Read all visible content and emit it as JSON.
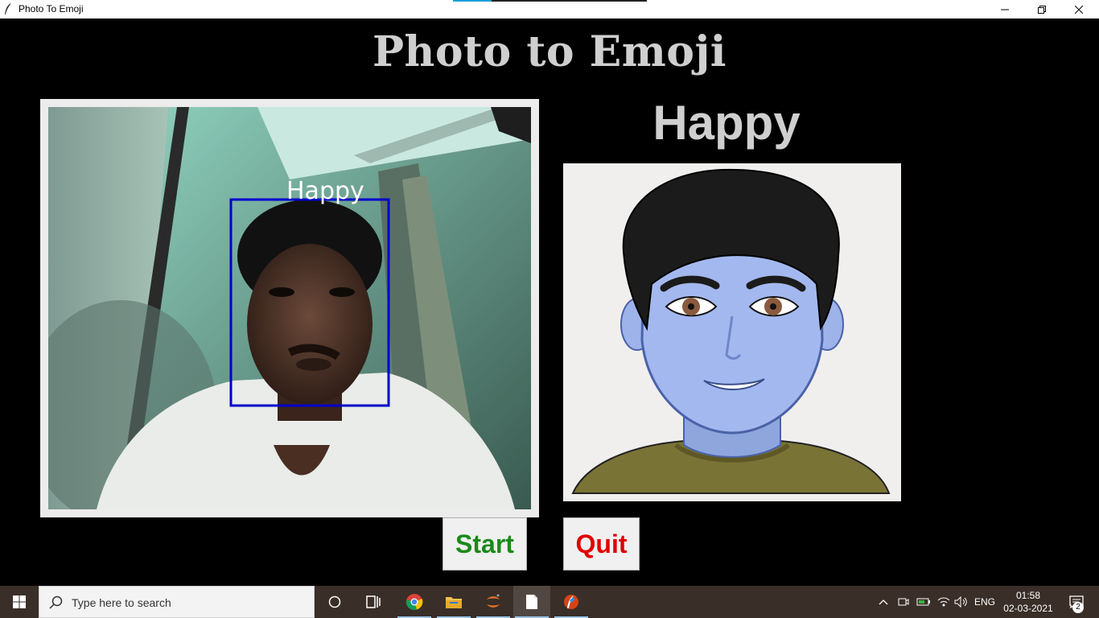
{
  "window": {
    "title": "Photo To Emoji",
    "controls": [
      "minimize",
      "restore",
      "close"
    ]
  },
  "app": {
    "heading": "Photo to Emoji",
    "face_box_label": "Happy",
    "detected_emotion": "Happy",
    "buttons": {
      "start_label": "Start",
      "quit_label": "Quit"
    },
    "colors": {
      "start": "#1a8a1a",
      "quit": "#e00000",
      "face_box": "#0000cc"
    }
  },
  "taskbar": {
    "search_placeholder": "Type here to search",
    "apps": [
      "cortana-icon",
      "task-view-icon",
      "chrome-icon",
      "file-explorer-icon",
      "jupyter-icon",
      "notepad-icon",
      "python-feather-icon"
    ],
    "language": "ENG",
    "time": "01:58",
    "date": "02-03-2021",
    "notification_count": "2"
  }
}
